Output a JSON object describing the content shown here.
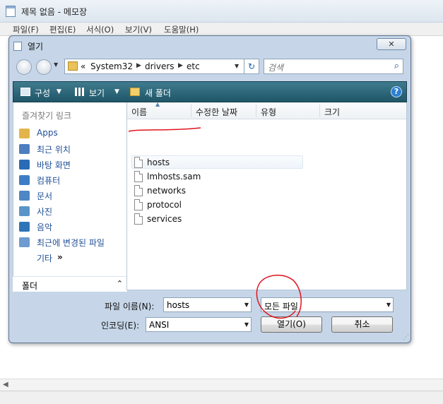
{
  "notepad": {
    "title": "제목 없음 - 메모장",
    "menu": [
      "파일(F)",
      "편집(E)",
      "서식(O)",
      "보기(V)",
      "도움말(H)"
    ]
  },
  "dialog": {
    "title": "열기",
    "close": "✕",
    "address": {
      "prefix": "«",
      "segments": [
        "System32",
        "drivers",
        "etc"
      ]
    },
    "search_placeholder": "검색",
    "toolbar": {
      "organize": "구성",
      "views": "보기",
      "new_folder": "새 폴더",
      "help": "?"
    },
    "favorites": {
      "header": "즐겨찾기 링크",
      "items": [
        {
          "label": "Apps",
          "icon": "folder-icon",
          "color": "#e3b44a"
        },
        {
          "label": "최근 위치",
          "icon": "recent-places-icon",
          "color": "#4d7fbf"
        },
        {
          "label": "바탕 화면",
          "icon": "desktop-icon",
          "color": "#2a6bb5"
        },
        {
          "label": "컴퓨터",
          "icon": "computer-icon",
          "color": "#3c7dc6"
        },
        {
          "label": "문서",
          "icon": "documents-icon",
          "color": "#4f86c4"
        },
        {
          "label": "사진",
          "icon": "pictures-icon",
          "color": "#5a95c8"
        },
        {
          "label": "음악",
          "icon": "music-icon",
          "color": "#2f74b8"
        },
        {
          "label": "최근에 변경된 파일",
          "icon": "recently-changed-icon",
          "color": "#6e9bd0"
        }
      ],
      "more": "기타",
      "more_arrow": "»"
    },
    "folders_label": "폴더",
    "folders_chevron": "⌃",
    "columns": [
      "이름",
      "수정한 날짜",
      "유형",
      "크기"
    ],
    "files": [
      "hosts",
      "lmhosts.sam",
      "networks",
      "protocol",
      "services"
    ],
    "filename_label": "파일 이름(N):",
    "filename_value": "hosts",
    "filetype_value": "모든 파일",
    "encoding_label": "인코딩(E):",
    "encoding_value": "ANSI",
    "open_button": "열기(O)",
    "cancel_button": "취소"
  },
  "colors": {
    "annotation": "#e0141e",
    "toolbar": "#2a6376",
    "link": "#1f4f95"
  }
}
